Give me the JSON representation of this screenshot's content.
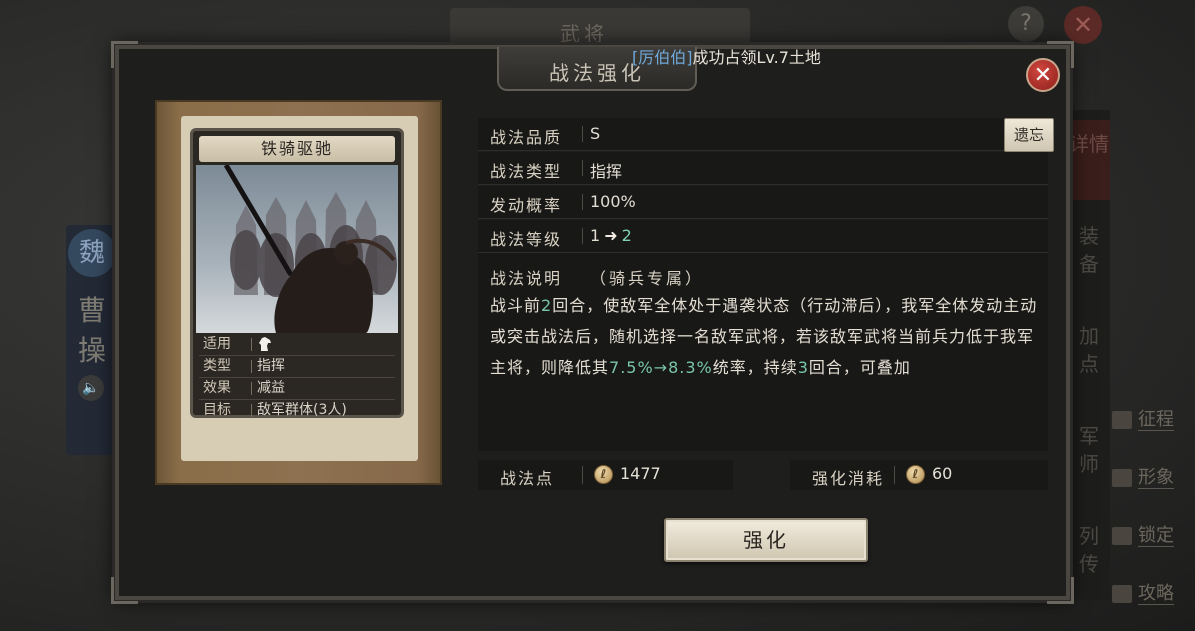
{
  "background": {
    "title": "武将",
    "help_icon": "?",
    "close_icon": "✕",
    "general": {
      "faction": "魏",
      "name_line1": "曹",
      "name_line2": "操"
    },
    "right_tabs": [
      "详情",
      "装备",
      "加点",
      "军师",
      "列传"
    ],
    "side_buttons": [
      "征程",
      "形象",
      "锁定",
      "攻略"
    ]
  },
  "notification": {
    "player": "[厉伯伯]",
    "message": "成功占领Lv.7土地"
  },
  "dialog": {
    "title": "战法强化",
    "close_icon": "✕",
    "forget_button": "遗忘",
    "enhance_button": "强化"
  },
  "card": {
    "name": "铁骑驱驰",
    "rows": [
      {
        "key": "适用",
        "value": ""
      },
      {
        "key": "类型",
        "value": "指挥"
      },
      {
        "key": "效果",
        "value": "减益"
      },
      {
        "key": "目标",
        "value": "敌军群体(3人)"
      }
    ],
    "applies_icon": "cavalry-horse-icon"
  },
  "info": {
    "quality_label": "战法品质",
    "quality_value": "S",
    "type_label": "战法类型",
    "type_value": "指挥",
    "rate_label": "发动概率",
    "rate_value": "100%",
    "level_label": "战法等级",
    "level_from": "1",
    "level_to": "2"
  },
  "description": {
    "title": "战法说明",
    "tag": "（骑兵专属）",
    "text_parts": {
      "p1": "战斗前",
      "n1": "2",
      "p2": "回合，使敌军全体处于遇袭状态（行动滞后），我军全体发动主动或突击战法后，随机选择一名敌军武将，若该敌军武将当前兵力低于我军主将，则降低其",
      "n2": "7.5%→8.3%",
      "p3": "统率，持续",
      "n3": "3",
      "p4": "回合，可叠加"
    }
  },
  "costs": {
    "points_label": "战法点",
    "points_value": "1477",
    "cost_label": "强化消耗",
    "cost_value": "60",
    "coin_icon": "tactic-point-coin-icon"
  },
  "colors": {
    "highlight": "#79c6a8",
    "player_name": "#6fa8d8",
    "close_red": "#c0392b"
  }
}
